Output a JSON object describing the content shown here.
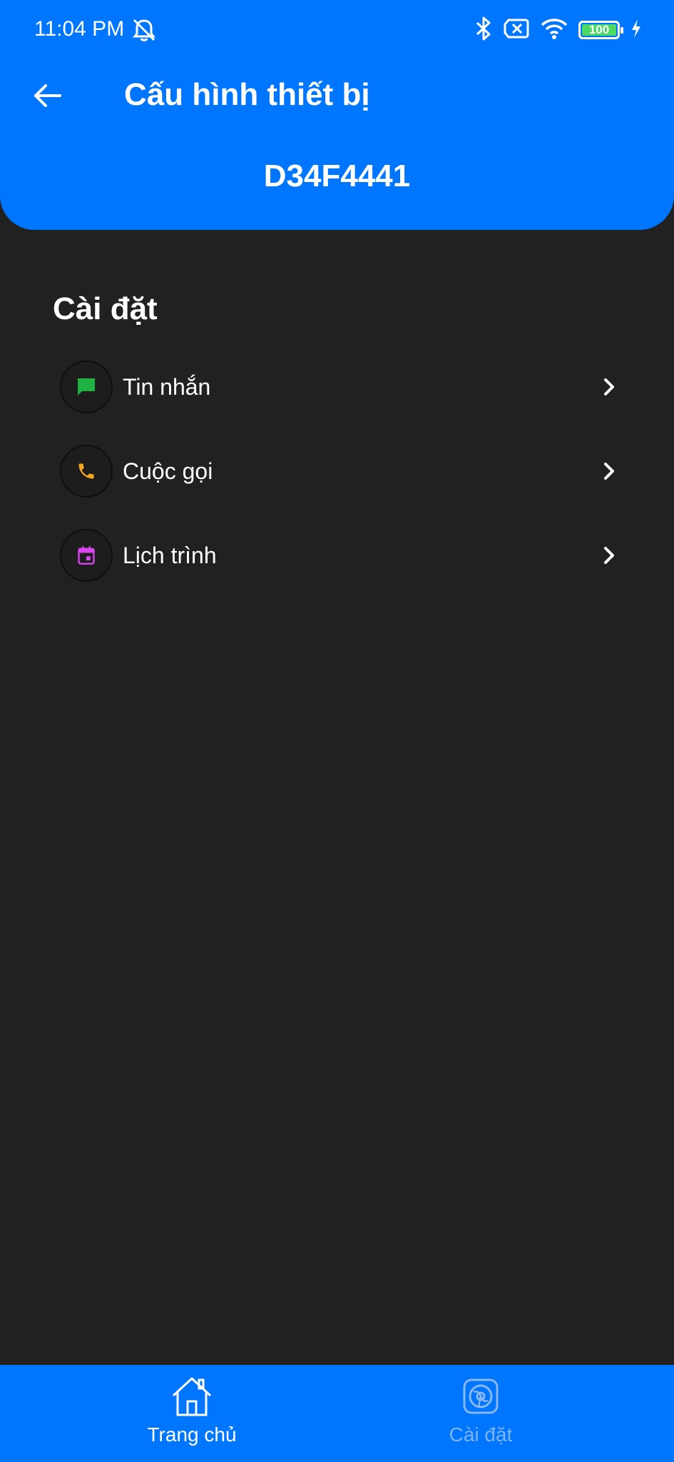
{
  "status_bar": {
    "time": "11:04 PM",
    "battery_level": "100",
    "icons": [
      "alarm-off-icon",
      "bluetooth-icon",
      "no-sim-icon",
      "wifi-icon",
      "battery-icon",
      "charging-icon"
    ]
  },
  "header": {
    "title": "Cấu hình thiết bị",
    "device_id": "D34F4441",
    "background_color": "#0076fe"
  },
  "settings": {
    "section_title": "Cài đặt",
    "items": [
      {
        "label": "Tin nhắn",
        "icon": "message-icon",
        "color": "#1fb141"
      },
      {
        "label": "Cuộc gọi",
        "icon": "phone-icon",
        "color": "#f5a623"
      },
      {
        "label": "Lịch trình",
        "icon": "calendar-icon",
        "color": "#d946ef"
      }
    ]
  },
  "bottom_nav": {
    "items": [
      {
        "label": "Trang chủ",
        "icon": "home-icon",
        "active": true
      },
      {
        "label": "Cài đặt",
        "icon": "settings-icon",
        "active": false
      }
    ]
  }
}
